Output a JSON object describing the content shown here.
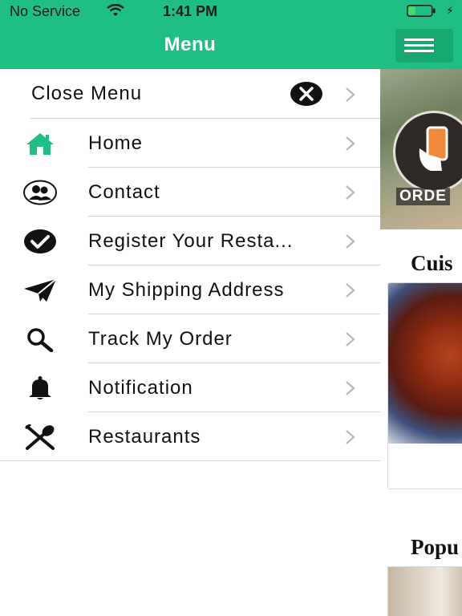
{
  "status_bar": {
    "carrier": "No Service",
    "time": "1:41 PM",
    "battery_level": 0.3
  },
  "menu": {
    "title": "Menu",
    "close_label": "Close Menu",
    "items": [
      {
        "label": "Home",
        "icon": "home-icon"
      },
      {
        "label": "Contact",
        "icon": "contacts-icon"
      },
      {
        "label": "Register Your Resta...",
        "icon": "checkmark-circle-icon"
      },
      {
        "label": "My Shipping Address",
        "icon": "paper-plane-icon"
      },
      {
        "label": "Track My Order",
        "icon": "search-icon"
      },
      {
        "label": "Notification",
        "icon": "bell-icon"
      },
      {
        "label": "Restaurants",
        "icon": "utensils-icon"
      }
    ]
  },
  "background_app": {
    "banner_text": "ORDE",
    "section_1_title": "Cuis",
    "section_2_title": "Popu"
  },
  "colors": {
    "accent": "#1fbf83",
    "accent_dark": "#17a86f",
    "home_icon": "#1fbf83",
    "text": "#111111"
  }
}
